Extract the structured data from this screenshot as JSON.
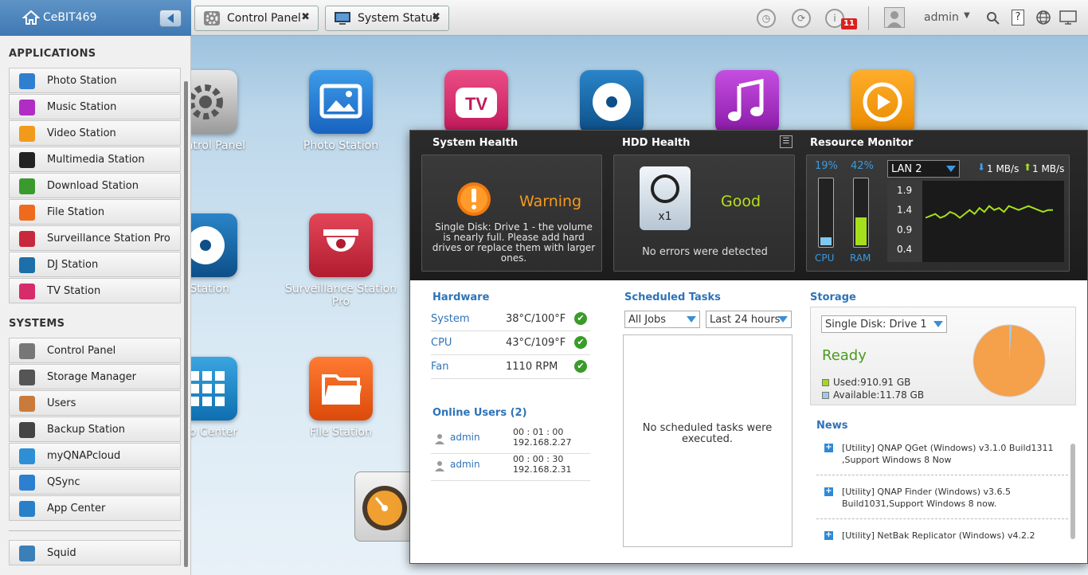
{
  "topbar": {
    "home_label": "CeBIT469",
    "tabs": [
      {
        "label": "Control Panel"
      },
      {
        "label": "System Status"
      }
    ],
    "notification_count": "11",
    "user": "admin"
  },
  "sidebar": {
    "applications_heading": "APPLICATIONS",
    "applications": [
      {
        "label": "Photo Station",
        "color": "#2f7fd0"
      },
      {
        "label": "Music Station",
        "color": "#b02cc4"
      },
      {
        "label": "Video Station",
        "color": "#f29a1c"
      },
      {
        "label": "Multimedia Station",
        "color": "#222222"
      },
      {
        "label": "Download Station",
        "color": "#3b9a2e"
      },
      {
        "label": "File Station",
        "color": "#f06a1e"
      },
      {
        "label": "Surveillance Station Pro",
        "color": "#c8283c"
      },
      {
        "label": "DJ Station",
        "color": "#1c6fa8"
      },
      {
        "label": "TV Station",
        "color": "#d62c6a"
      }
    ],
    "systems_heading": "SYSTEMS",
    "systems": [
      {
        "label": "Control Panel",
        "color": "#777777"
      },
      {
        "label": "Storage Manager",
        "color": "#555555"
      },
      {
        "label": "Users",
        "color": "#c97b3c"
      },
      {
        "label": "Backup Station",
        "color": "#444444"
      },
      {
        "label": "myQNAPcloud",
        "color": "#2d8fd6"
      },
      {
        "label": "QSync",
        "color": "#2d7fd0"
      },
      {
        "label": "App Center",
        "color": "#2a80c8"
      }
    ],
    "extra": [
      {
        "label": "Squid",
        "color": "#3a7fb8"
      }
    ]
  },
  "desktop": {
    "icons": [
      {
        "label": "Control Panel"
      },
      {
        "label": "Photo Station"
      },
      {
        "label": "Station"
      },
      {
        "label": "Surveillance Station Pro"
      },
      {
        "label": "p Center"
      },
      {
        "label": "File Station"
      }
    ]
  },
  "status": {
    "system_health": {
      "heading": "System Health",
      "state": "Warning",
      "message": "Single Disk: Drive 1 - the volume is nearly full. Please add hard drives or replace them with larger ones."
    },
    "hdd_health": {
      "heading": "HDD Health",
      "disk_count": "x1",
      "state": "Good",
      "message": "No errors were detected"
    },
    "resource_monitor": {
      "heading": "Resource Monitor",
      "cpu_percent": "19%",
      "ram_percent": "42%",
      "cpu_fraction": 0.19,
      "ram_fraction": 0.42,
      "cpu_label": "CPU",
      "ram_label": "RAM",
      "lan_select": "LAN 2",
      "download": "1 MB/s",
      "upload": "1 MB/s",
      "y_ticks": [
        "1.9",
        "1.4",
        "0.9",
        "0.4"
      ]
    },
    "hardware": {
      "heading": "Hardware",
      "rows": [
        {
          "label": "System",
          "value": "38°C/100°F"
        },
        {
          "label": "CPU",
          "value": "43°C/109°F"
        },
        {
          "label": "Fan",
          "value": "1110 RPM"
        }
      ]
    },
    "online_users": {
      "heading": "Online Users (2)",
      "users": [
        {
          "name": "admin",
          "time": "00 : 01 : 00",
          "ip": "192.168.2.27"
        },
        {
          "name": "admin",
          "time": "00 : 00 : 30",
          "ip": "192.168.2.31"
        }
      ]
    },
    "scheduled_tasks": {
      "heading": "Scheduled Tasks",
      "filter_jobs": "All Jobs",
      "filter_time": "Last 24 hours",
      "empty_message": "No scheduled tasks were executed."
    },
    "storage": {
      "heading": "Storage",
      "disk_select": "Single Disk: Drive  1",
      "state": "Ready",
      "used": "Used:910.91 GB",
      "available": "Available:11.78 GB",
      "used_color": "#f5a04a",
      "available_color": "#a0c8e8"
    },
    "news": {
      "heading": "News",
      "items": [
        {
          "text": "[Utility] QNAP QGet (Windows) v3.1.0 Build1311 ,Support Windows 8 Now"
        },
        {
          "text": "[Utility] QNAP Finder (Windows) v3.6.5 Build1031,Support Windows 8 now."
        },
        {
          "text": "[Utility] NetBak Replicator (Windows) v4.2.2"
        }
      ]
    }
  },
  "chart_data": {
    "type": "line",
    "y_ticks": [
      "1.9",
      "1.4",
      "0.9",
      "0.4"
    ],
    "ylim": [
      0.4,
      1.9
    ],
    "series": [
      {
        "values": [
          1.2,
          1.25,
          1.3,
          1.2,
          1.25,
          1.35,
          1.3,
          1.2,
          1.3,
          1.4,
          1.3,
          1.45,
          1.35,
          1.5,
          1.4,
          1.45,
          1.35,
          1.5,
          1.45,
          1.4,
          1.45,
          1.5,
          1.45,
          1.4,
          1.35,
          1.4,
          1.4
        ]
      }
    ]
  }
}
